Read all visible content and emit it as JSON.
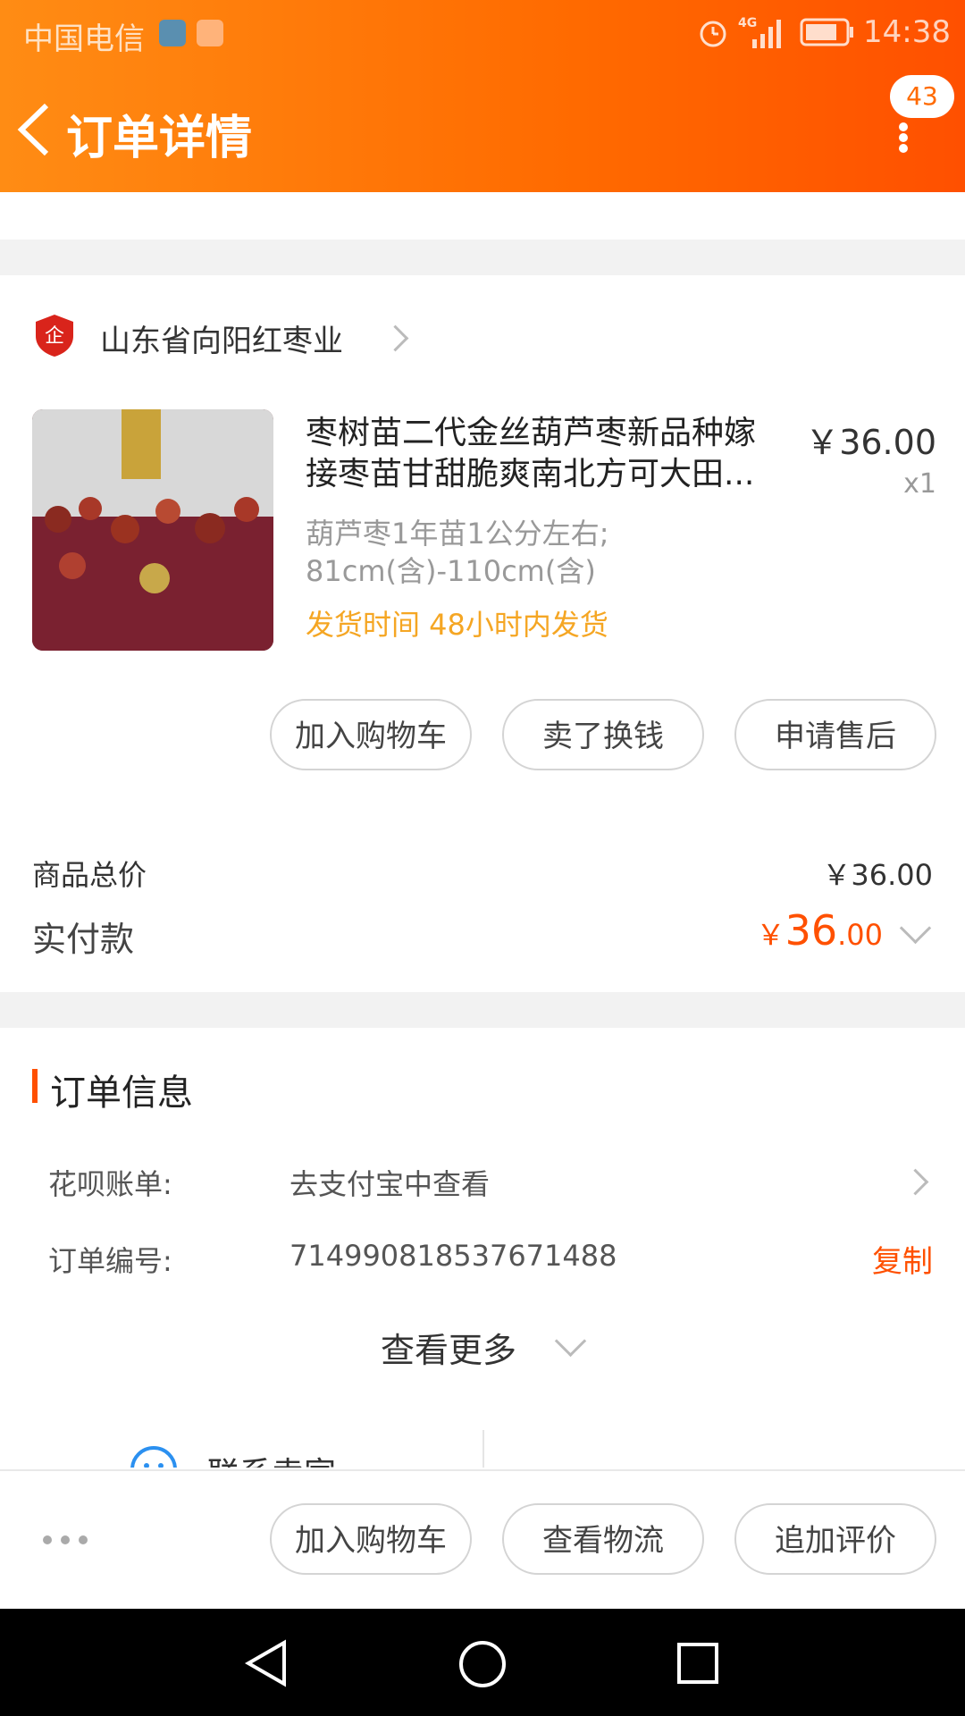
{
  "status_bar": {
    "carrier": "中国电信",
    "time": "14:38",
    "network": "4G"
  },
  "header": {
    "title": "订单详情",
    "badge_count": "43"
  },
  "shop": {
    "name": "山东省向阳红枣业",
    "logo_text": "企"
  },
  "product": {
    "title": "枣树苗二代金丝葫芦枣新品种嫁接枣苗甘甜脆爽南北方可大田...",
    "title_line1": "枣树苗二代金丝葫芦枣新品种嫁",
    "title_line2": "接枣苗甘甜脆爽南北方可大田...",
    "price": "￥36.00",
    "quantity": "x1",
    "sku_line1": "葫芦枣1年苗1公分左右;",
    "sku_line2": "81cm(含)-110cm(含)",
    "shipping": "发货时间 48小时内发货"
  },
  "item_actions": {
    "add_cart": "加入购物车",
    "resell": "卖了换钱",
    "after_sale": "申请售后"
  },
  "totals": {
    "goods_total_label": "商品总价",
    "goods_total_value": "￥36.00",
    "paid_label": "实付款",
    "paid_currency": "￥",
    "paid_int": "36",
    "paid_dec": ".00"
  },
  "order_info": {
    "heading": "订单信息",
    "huabei_label": "花呗账单:",
    "huabei_value": "去支付宝中查看",
    "order_no_label": "订单编号:",
    "order_no_value": "714990818537671488",
    "copy_label": "复制",
    "more_label": "查看更多"
  },
  "contact": {
    "label": "联系卖家"
  },
  "bottom_bar": {
    "add_cart": "加入购物车",
    "logistics": "查看物流",
    "review": "追加评价"
  },
  "colors": {
    "accent": "#ff5000",
    "shipping_text": "#f5a623",
    "header_start": "#ff8c14"
  }
}
